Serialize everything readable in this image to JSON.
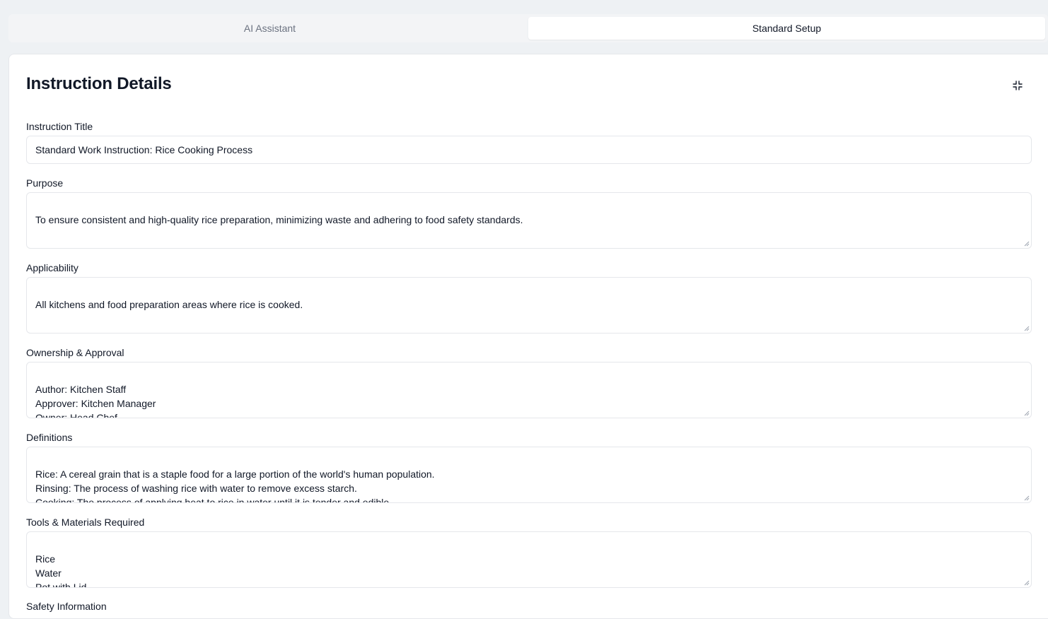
{
  "tabs": [
    {
      "label": "AI Assistant",
      "active": false
    },
    {
      "label": "Standard Setup",
      "active": true
    }
  ],
  "card": {
    "title": "Instruction Details",
    "collapse_icon": "minimize-icon"
  },
  "fields": {
    "title": {
      "label": "Instruction Title",
      "value": "Standard Work Instruction: Rice Cooking Process"
    },
    "purpose": {
      "label": "Purpose",
      "value": "To ensure consistent and high-quality rice preparation, minimizing waste and adhering to food safety standards."
    },
    "applicability": {
      "label": "Applicability",
      "value": "All kitchens and food preparation areas where rice is cooked."
    },
    "ownership": {
      "label": "Ownership & Approval",
      "value": "Author: Kitchen Staff\nApprover: Kitchen Manager\nOwner: Head Chef"
    },
    "definitions": {
      "label": "Definitions",
      "value": "Rice: A cereal grain that is a staple food for a large portion of the world's human population.\nRinsing: The process of washing rice with water to remove excess starch.\nCooking: The process of applying heat to rice in water until it is tender and edible."
    },
    "tools": {
      "label": "Tools & Materials Required",
      "value": "Rice\nWater\nPot with Lid\nMeasuring Cup"
    },
    "safety": {
      "label": "Safety Information"
    }
  },
  "colors": {
    "accent": "#111827",
    "muted": "#6b7280",
    "border": "#e5e7eb",
    "page_bg": "#eef1f4"
  }
}
